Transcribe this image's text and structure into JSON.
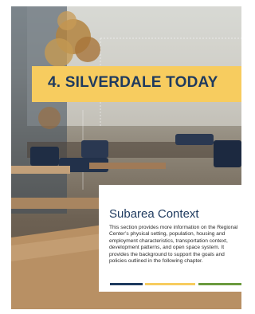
{
  "banner": {
    "title": "4.  SILVERDALE TODAY"
  },
  "card": {
    "heading": "Subarea Context",
    "body": "This section provides more information on the Regional Center’s physical setting, population, housing and employment characteristics, transportation context, development patterns, and open space system. It provides the background to support the goals and policies outlined in the following chapter."
  },
  "colors": {
    "banner_background": "#f7cc5f",
    "heading_text": "#1e3a5f",
    "rule_navy": "#1e3a5f",
    "rule_gold": "#f7cc5f",
    "rule_green": "#6b9a3e"
  },
  "photo": {
    "subject": "cafe-interior-photo"
  }
}
